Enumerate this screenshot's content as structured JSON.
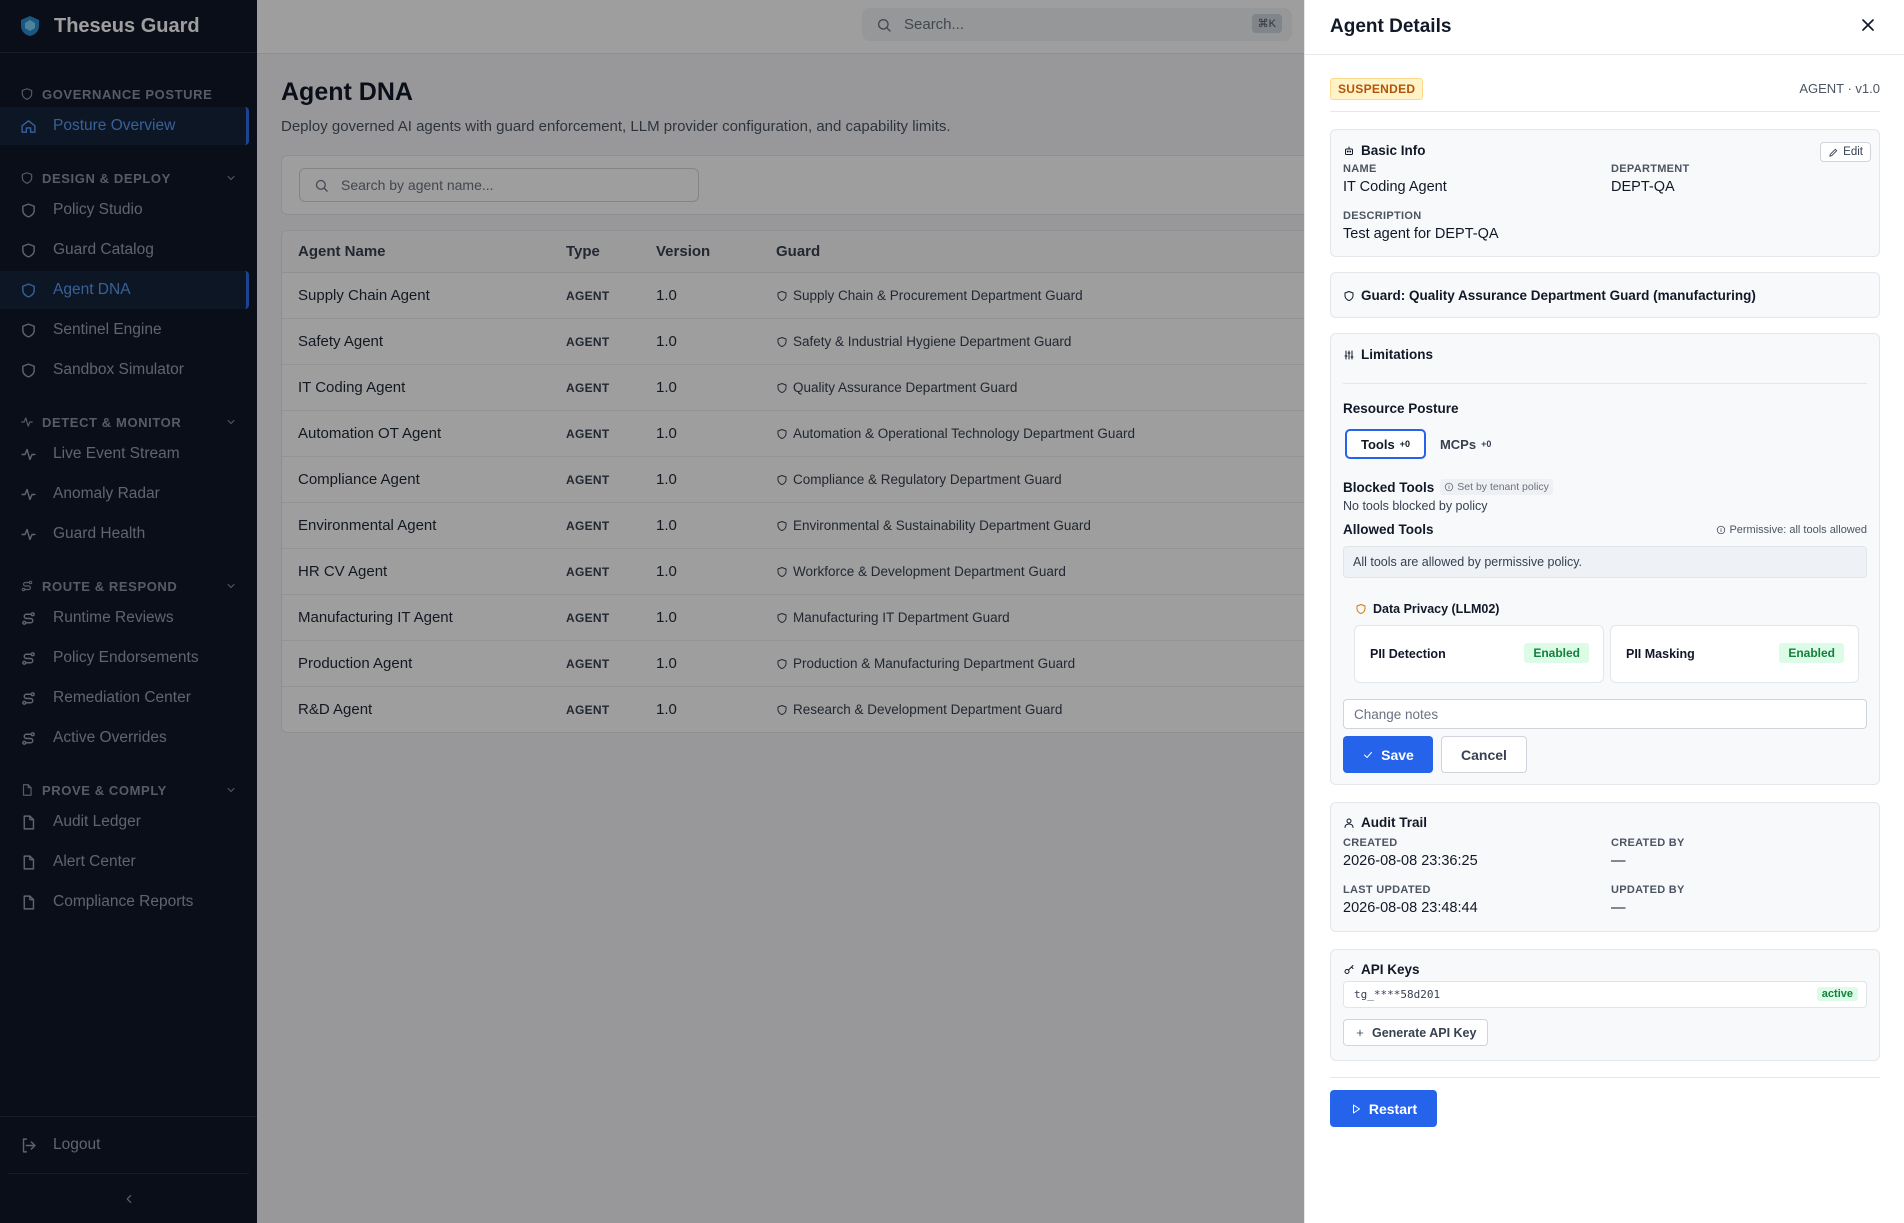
{
  "app": {
    "name": "Theseus Guard"
  },
  "sidebar": {
    "sections": [
      {
        "title": "GOVERNANCE POSTURE",
        "items": [
          {
            "label": "Posture Overview"
          }
        ]
      },
      {
        "title": "DESIGN & DEPLOY",
        "items": [
          {
            "label": "Policy Studio"
          },
          {
            "label": "Guard Catalog"
          },
          {
            "label": "Agent DNA"
          },
          {
            "label": "Sentinel Engine"
          },
          {
            "label": "Sandbox Simulator"
          }
        ]
      },
      {
        "title": "DETECT & MONITOR",
        "items": [
          {
            "label": "Live Event Stream"
          },
          {
            "label": "Anomaly Radar"
          },
          {
            "label": "Guard Health"
          }
        ]
      },
      {
        "title": "ROUTE & RESPOND",
        "items": [
          {
            "label": "Runtime Reviews"
          },
          {
            "label": "Policy Endorsements"
          },
          {
            "label": "Remediation Center"
          },
          {
            "label": "Active Overrides"
          }
        ]
      },
      {
        "title": "PROVE & COMPLY",
        "items": [
          {
            "label": "Audit Ledger"
          },
          {
            "label": "Alert Center"
          },
          {
            "label": "Compliance Reports"
          }
        ]
      }
    ],
    "logout": "Logout"
  },
  "topbar": {
    "search_placeholder": "Search...",
    "shortcut": "⌘K"
  },
  "page": {
    "title": "Agent DNA",
    "subtitle": "Deploy governed AI agents with guard enforcement, LLM provider configuration, and capability limits.",
    "search_placeholder": "Search by agent name..."
  },
  "table": {
    "headers": [
      "Agent Name",
      "Type",
      "Version",
      "Guard"
    ],
    "rows": [
      {
        "name": "Supply Chain Agent",
        "type": "AGENT",
        "version": "1.0",
        "guard": "Supply Chain & Procurement Department Guard"
      },
      {
        "name": "Safety Agent",
        "type": "AGENT",
        "version": "1.0",
        "guard": "Safety & Industrial Hygiene Department Guard"
      },
      {
        "name": "IT Coding Agent",
        "type": "AGENT",
        "version": "1.0",
        "guard": "Quality Assurance Department Guard"
      },
      {
        "name": "Automation OT Agent",
        "type": "AGENT",
        "version": "1.0",
        "guard": "Automation & Operational Technology Department Guard"
      },
      {
        "name": "Compliance Agent",
        "type": "AGENT",
        "version": "1.0",
        "guard": "Compliance & Regulatory Department Guard"
      },
      {
        "name": "Environmental Agent",
        "type": "AGENT",
        "version": "1.0",
        "guard": "Environmental & Sustainability Department Guard"
      },
      {
        "name": "HR CV Agent",
        "type": "AGENT",
        "version": "1.0",
        "guard": "Workforce & Development Department Guard"
      },
      {
        "name": "Manufacturing IT Agent",
        "type": "AGENT",
        "version": "1.0",
        "guard": "Manufacturing IT Department Guard"
      },
      {
        "name": "Production Agent",
        "type": "AGENT",
        "version": "1.0",
        "guard": "Production & Manufacturing Department Guard"
      },
      {
        "name": "R&D Agent",
        "type": "AGENT",
        "version": "1.0",
        "guard": "Research & Development Department Guard"
      }
    ]
  },
  "drawer": {
    "title": "Agent Details",
    "status": "SUSPENDED",
    "kind": "AGENT · v1.0",
    "basic": {
      "title": "Basic Info",
      "edit": "Edit",
      "name_label": "NAME",
      "name": "IT Coding Agent",
      "dept_label": "DEPARTMENT",
      "dept": "DEPT-QA",
      "desc_label": "DESCRIPTION",
      "desc": "Test agent for DEPT-QA"
    },
    "guard": "Guard: Quality Assurance Department Guard (manufacturing)",
    "limitations": {
      "title": "Limitations",
      "resource_posture": "Resource Posture",
      "tab_tools": "Tools",
      "tab_tools_count": "+0",
      "tab_mcps": "MCPs",
      "tab_mcps_count": "+0",
      "blocked_title": "Blocked Tools",
      "blocked_hint": "Set by tenant policy",
      "blocked_text": "No tools blocked by policy",
      "allowed_title": "Allowed Tools",
      "allowed_hint": "Permissive: all tools allowed",
      "allowed_text": "All tools are allowed by permissive policy.",
      "privacy_title": "Data Privacy (LLM02)",
      "pii_detection": "PII Detection",
      "pii_detection_status": "Enabled",
      "pii_masking": "PII Masking",
      "pii_masking_status": "Enabled",
      "notes_placeholder": "Change notes",
      "save": "Save",
      "cancel": "Cancel"
    },
    "audit": {
      "title": "Audit Trail",
      "created_label": "CREATED",
      "created": "2026-08-08 23:36:25",
      "created_by_label": "CREATED BY",
      "created_by": "—",
      "updated_label": "LAST UPDATED",
      "updated": "2026-08-08 23:48:44",
      "updated_by_label": "UPDATED BY",
      "updated_by": "—"
    },
    "api": {
      "title": "API Keys",
      "key": "tg_****58d201",
      "key_status": "active",
      "generate": "Generate API Key"
    },
    "restart": "Restart"
  },
  "colors": {
    "accent": "#2563eb",
    "sidebar_bg": "#101828",
    "warning": "#b45309",
    "success": "#15803d"
  }
}
